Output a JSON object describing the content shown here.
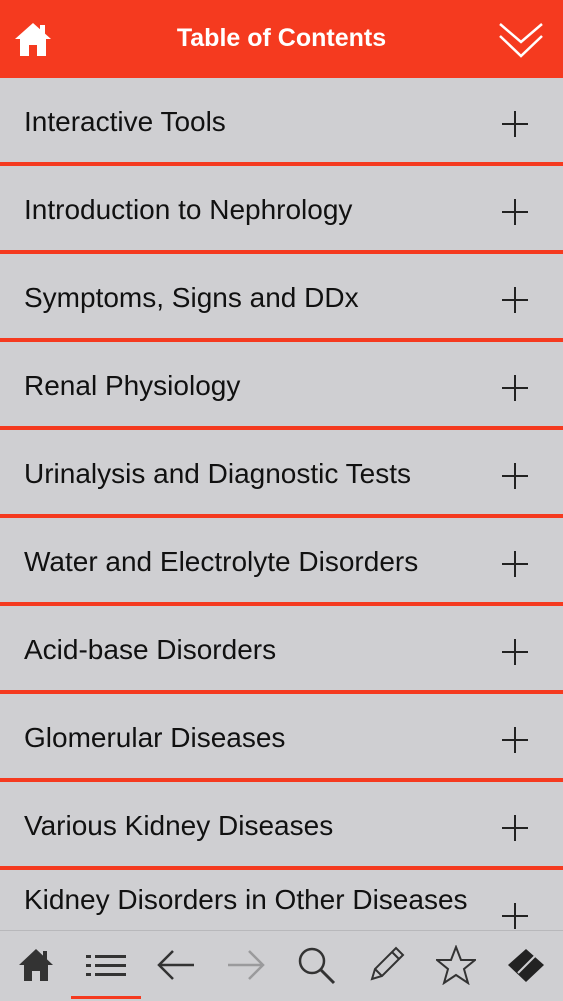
{
  "header": {
    "title": "Table of Contents",
    "home_icon": "home-icon",
    "collapse_icon": "double-chevron-down-icon"
  },
  "toc": {
    "items": [
      {
        "label": "Interactive Tools"
      },
      {
        "label": "Introduction to Nephrology"
      },
      {
        "label": "Symptoms, Signs and DDx"
      },
      {
        "label": "Renal Physiology"
      },
      {
        "label": "Urinalysis and Diagnostic Tests"
      },
      {
        "label": "Water and Electrolyte Disorders"
      },
      {
        "label": "Acid-base Disorders"
      },
      {
        "label": "Glomerular Diseases"
      },
      {
        "label": "Various Kidney Diseases"
      },
      {
        "label": "Kidney Disorders in Other Diseases"
      }
    ],
    "expand_icon": "plus-icon"
  },
  "tabbar": {
    "tabs": [
      {
        "icon": "home-icon"
      },
      {
        "icon": "list-icon",
        "active": true
      },
      {
        "icon": "arrow-left-icon"
      },
      {
        "icon": "arrow-right-icon"
      },
      {
        "icon": "search-icon"
      },
      {
        "icon": "pencil-icon"
      },
      {
        "icon": "star-icon"
      },
      {
        "icon": "eraser-icon"
      }
    ]
  },
  "colors": {
    "accent": "#f53a1f",
    "row_background": "#cfcfd2",
    "text": "#111111",
    "icon": "#333333"
  }
}
